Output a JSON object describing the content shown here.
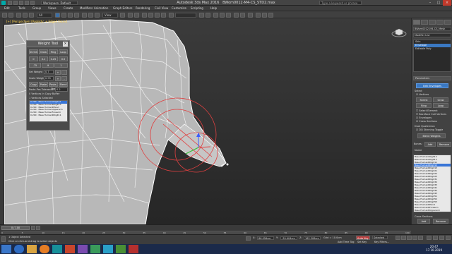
{
  "app": {
    "title": "Autodesk 3ds Max 2016",
    "file": "BWom0012-M4-CS_STD2.max",
    "workspace": "Workspace: Default",
    "search_placeholder": "Type a keyword or phrase"
  },
  "menu": [
    "Edit",
    "Tools",
    "Group",
    "Views",
    "Create",
    "Modifiers",
    "Animation",
    "Graph Editors",
    "Rendering",
    "Civil View",
    "Customize",
    "Scripting",
    "Help"
  ],
  "viewport": {
    "label": "[+] [Perspective] [Realistic + Edged Faces]"
  },
  "weight_tool": {
    "title": "Weight Tool",
    "row1": [
      "Shrink",
      "Grow",
      "Ring",
      "Loop"
    ],
    "row2": [
      "0",
      "0.1",
      "0.25",
      "0.5"
    ],
    "row3": [
      ".75",
      ".9",
      "1"
    ],
    "set_weight_label": "Set Weight",
    "set_weight_value": "0.7",
    "scale_weight_label": "Scale Weight",
    "scale_weight_value": "0.95",
    "row4": [
      "Copy",
      "Paste",
      "Paste-Pos",
      "Blend"
    ],
    "tolerance_label": "Paste-Pos Tolerance",
    "tolerance_value": "0.2",
    "copy_buffer_label": "0 Vertices In Copy Buffer",
    "selected_label": "1 Vertices Selected",
    "list": [
      {
        "text": "0.200 : Base HumanLDigit12",
        "selected": true
      },
      {
        "text": "0.200 : Base HumanRDigit13",
        "selected": false
      },
      {
        "text": "0.200 : Base HumanRHand",
        "selected": false
      },
      {
        "text": "0.200 : Base HumanUpperarm",
        "selected": false
      },
      {
        "text": "0.200 : Base HumanForearm",
        "selected": false
      },
      {
        "text": "0.200 : Base HumanRDigit11",
        "selected": false
      }
    ]
  },
  "command_panel": {
    "object_name": "BWom0012-M4-CS_Mesh",
    "modifier_list": "Modifier List",
    "stack": [
      {
        "text": "Skin",
        "selected": false
      },
      {
        "text": "Envelope",
        "selected": true
      },
      {
        "text": "Editable Poly",
        "selected": false
      }
    ],
    "parameters": "Parameters",
    "edit_envelopes": "Edit Envelopes",
    "select_label": "Select",
    "vertices_label": "Vertices",
    "shrink": "Shrink",
    "grow": "Grow",
    "ring": "Ring",
    "loop": "Loop",
    "select_element": "Select Element",
    "backface": "Backface Cull Vertices",
    "envelopes": "Envelopes",
    "cross_sections": "Cross Sections",
    "dual_quaternion": "Dual Quaternion",
    "dq_toggle": "DQ Skinning Toggle",
    "blend_weights": "Blend Weights",
    "bones_label": "Bones:",
    "add": "Add",
    "remove": "Remove",
    "name_label": "Name",
    "bones": [
      {
        "text": "Base HumanLDigit12",
        "selected": false
      },
      {
        "text": "Base HumanLDigit13",
        "selected": false
      },
      {
        "text": "Base HumanRDigit11",
        "selected": false
      },
      {
        "text": "Base HumanRDigit12",
        "selected": true
      },
      {
        "text": "Base HumanRDigit13",
        "selected": false
      },
      {
        "text": "Base HumanRDigit21",
        "selected": false
      },
      {
        "text": "Base HumanRDigit22",
        "selected": false
      },
      {
        "text": "Base HumanRDigit23",
        "selected": false
      },
      {
        "text": "Base HumanRDigit31",
        "selected": false
      },
      {
        "text": "Base HumanRDigit32",
        "selected": false
      },
      {
        "text": "Base HumanRDigit33",
        "selected": false
      },
      {
        "text": "Base HumanRDigit41",
        "selected": false
      },
      {
        "text": "Base HumanRDigit42",
        "selected": false
      },
      {
        "text": "Base HumanRDigit43",
        "selected": false
      },
      {
        "text": "Base HumanRDigit51",
        "selected": false
      },
      {
        "text": "Base HumanRDigit52",
        "selected": false
      },
      {
        "text": "Base HumanRDigit53",
        "selected": false
      },
      {
        "text": "Base HumanRHand",
        "selected": false
      },
      {
        "text": "Base HumanRForearm",
        "selected": false
      },
      {
        "text": "Base HumanRUpperarm",
        "selected": false
      }
    ],
    "cross_sections_section": "Cross Sections",
    "cs_add": "Add",
    "cs_remove": "Remove",
    "envelope_properties": "Envelope Properties",
    "radius_label": "Radius:",
    "radius_value": "0.0",
    "squash_label": "Squash:",
    "squash_value": "1.0"
  },
  "timeline": {
    "slider": "0 / 100",
    "ticks": [
      "0",
      "5",
      "10",
      "15",
      "20",
      "25",
      "30",
      "35",
      "40",
      "45",
      "50",
      "55",
      "60",
      "65",
      "70",
      "75",
      "80",
      "85",
      "90",
      "95",
      "100"
    ]
  },
  "status": {
    "selected": "1 Object Selected",
    "prompt": "Click or click-and-drag to select objects",
    "x_label": "X:",
    "x_value": "86.056cm",
    "y_label": "Y:",
    "y_value": "-39.404cm",
    "z_label": "Z:",
    "z_value": "182.308cm",
    "grid": "Grid = 10.0cm",
    "add_time_tag": "Add Time Tag",
    "auto_key": "Auto Key",
    "set_key": "Set Key",
    "selected_dd": "Selected",
    "key_filters": "Key Filters..."
  },
  "taskbar": {
    "time": "20:47",
    "date": "17.10.2019"
  },
  "colors": {
    "accent": "#3a78c2",
    "list_selected": "#3875d7",
    "taskbar": "#1b2a4a",
    "envelope": "#e04040"
  }
}
